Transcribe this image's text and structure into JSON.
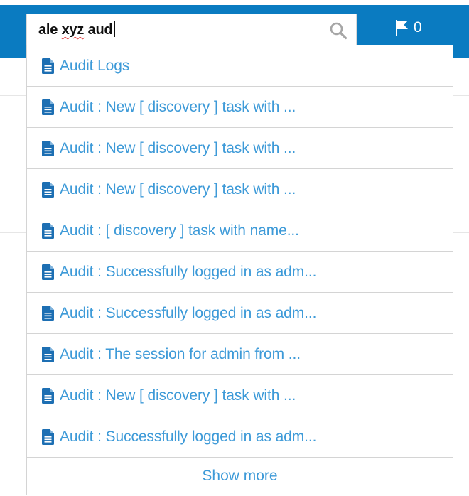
{
  "search": {
    "query_prefix": "ale ",
    "query_misspelled": "xyz",
    "query_suffix": " aud"
  },
  "flags": {
    "count": "0",
    "icon": "flag-icon"
  },
  "results": [
    {
      "label": "Audit Logs",
      "icon": "document-icon"
    },
    {
      "label": "Audit : New [ discovery ] task with ...",
      "icon": "document-icon"
    },
    {
      "label": "Audit : New [ discovery ] task with ...",
      "icon": "document-icon"
    },
    {
      "label": "Audit : New [ discovery ] task with ...",
      "icon": "document-icon"
    },
    {
      "label": "Audit : [ discovery ] task with name...",
      "icon": "document-icon"
    },
    {
      "label": "Audit : Successfully logged in as adm...",
      "icon": "document-icon"
    },
    {
      "label": "Audit : Successfully logged in as adm...",
      "icon": "document-icon"
    },
    {
      "label": "Audit : The session for admin from ...",
      "icon": "document-icon"
    },
    {
      "label": "Audit : New [ discovery ] task with ...",
      "icon": "document-icon"
    },
    {
      "label": "Audit : Successfully logged in as adm...",
      "icon": "document-icon"
    }
  ],
  "show_more_label": "Show more",
  "colors": {
    "header_blue": "#0a7bc1",
    "link_blue": "#3d9ad8",
    "icon_blue": "#1d6fb3"
  }
}
